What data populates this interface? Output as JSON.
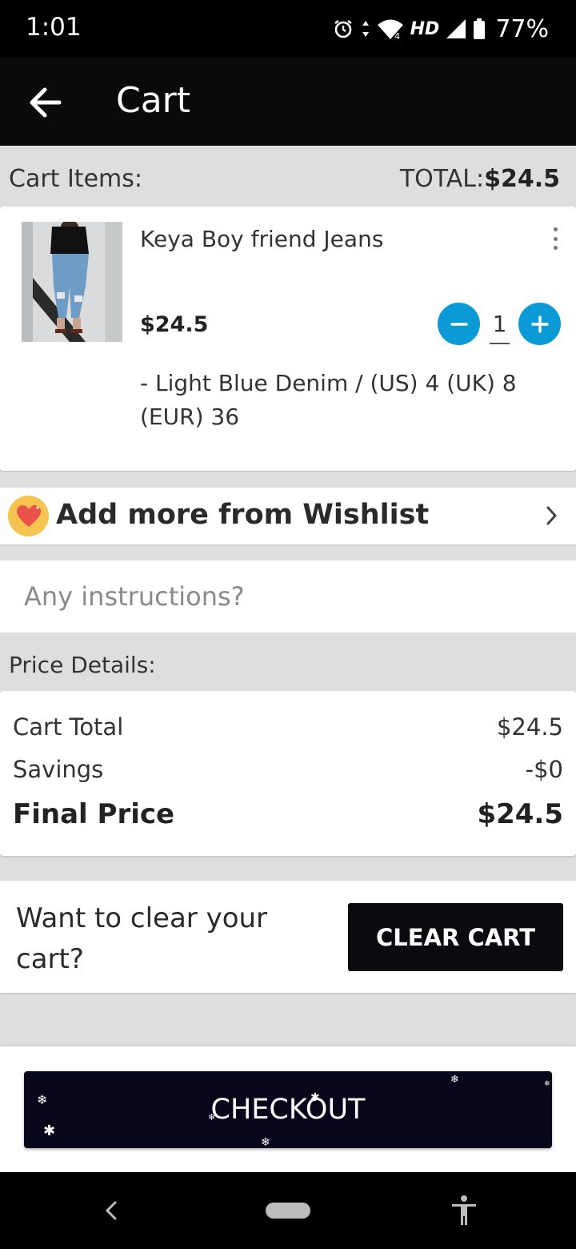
{
  "status_bar": {
    "time": "1:01",
    "network_label": "HD",
    "network_gen": "4",
    "battery": "77%"
  },
  "app_bar": {
    "title": "Cart",
    "back_icon": "arrow-left-icon"
  },
  "cart_header": {
    "label": "Cart Items:",
    "total_label": "TOTAL:",
    "total_value": "$24.5"
  },
  "item": {
    "name": "Keya Boy friend Jeans",
    "price": "$24.5",
    "quantity": "1",
    "variant": "- Light Blue Denim / (US) 4 (UK) 8 (EUR) 36"
  },
  "wishlist": {
    "label": "Add more from Wishlist",
    "icon": "heart-icon"
  },
  "instructions": {
    "placeholder": "Any instructions?",
    "value": ""
  },
  "price_details": {
    "header": "Price Details:",
    "rows": [
      {
        "label": "Cart Total",
        "value": "$24.5"
      },
      {
        "label": "Savings",
        "value": "-$0"
      },
      {
        "label": "Final Price",
        "value": "$24.5"
      }
    ]
  },
  "clear_cart": {
    "text": "Want to clear your cart?",
    "button_label": "CLEAR CART"
  },
  "checkout": {
    "button_label": "CHECKOUT"
  },
  "colors": {
    "accent_blue": "#0a9bd6",
    "dark_button": "#0a0a0f",
    "wishlist_yellow": "#f5c44e",
    "heart_red": "#e8524a"
  }
}
